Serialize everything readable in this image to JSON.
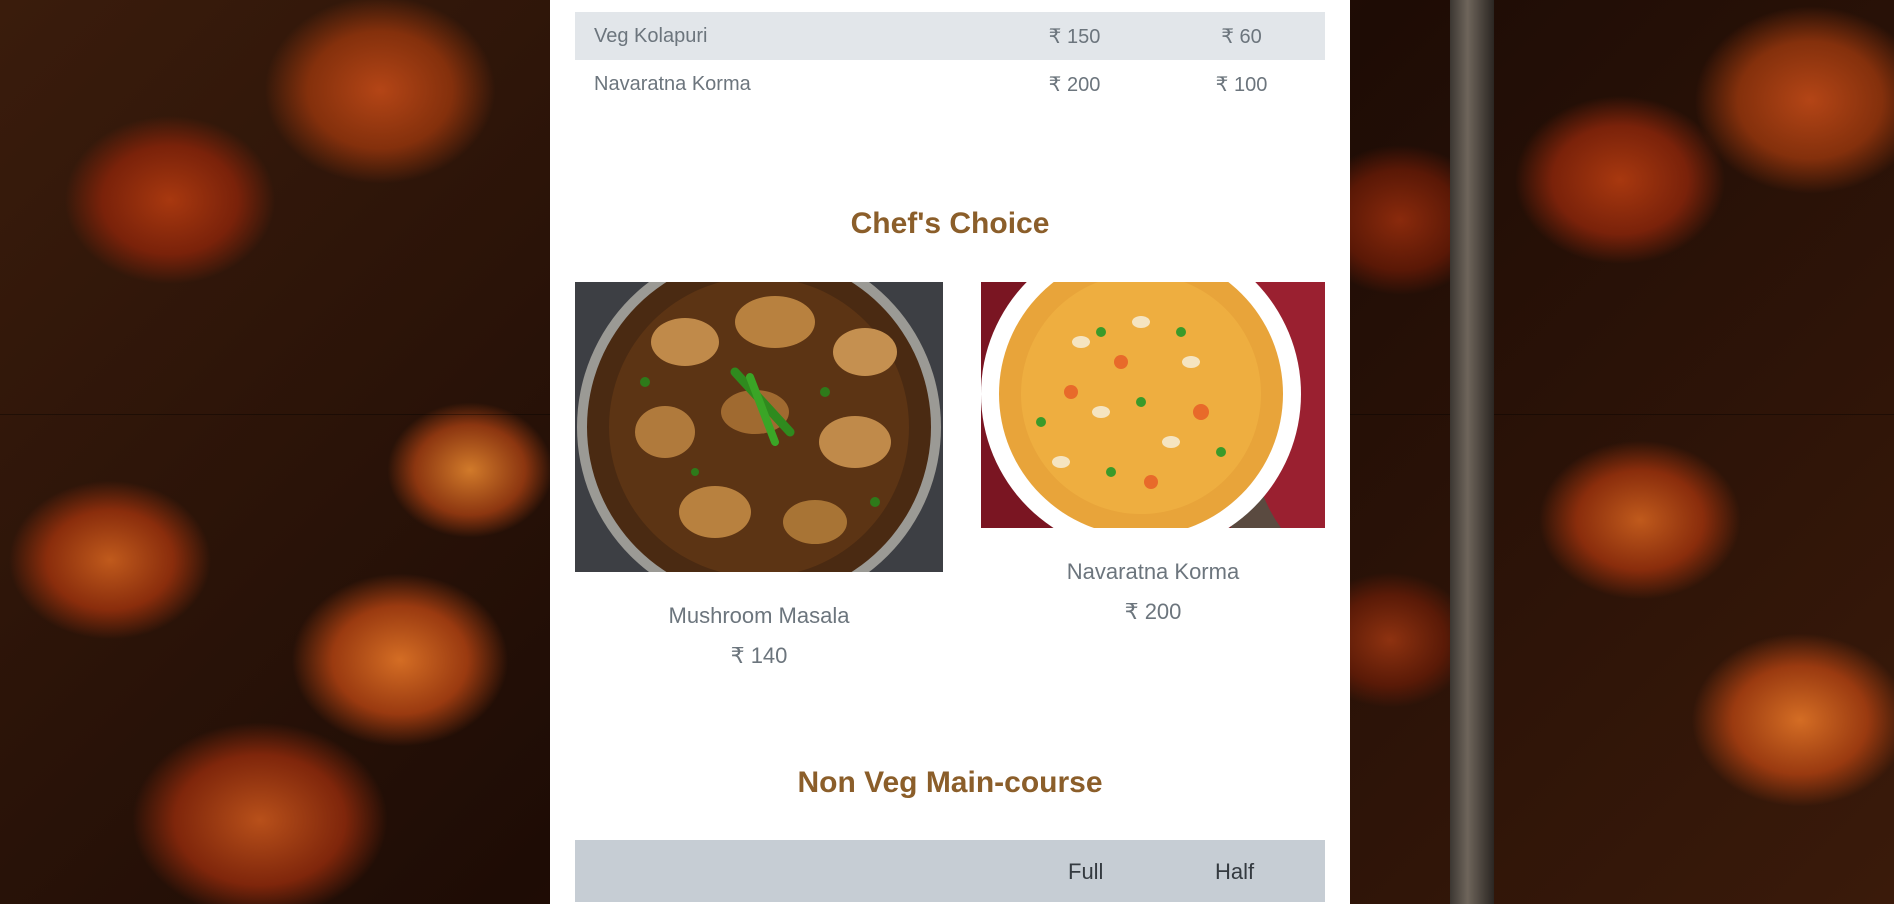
{
  "veg_table": {
    "rows": [
      {
        "name": "Veg Kolapuri",
        "full": "₹ 150",
        "half": "₹ 60"
      },
      {
        "name": "Navaratna Korma",
        "full": "₹ 200",
        "half": "₹ 100"
      }
    ]
  },
  "chefs_choice": {
    "title": "Chef's Choice",
    "items": [
      {
        "name": "Mushroom Masala",
        "price": "₹ 140"
      },
      {
        "name": "Navaratna Korma",
        "price": "₹ 200"
      }
    ]
  },
  "non_veg": {
    "title": "Non Veg Main-course",
    "header": {
      "full": "Full",
      "half": "Half"
    }
  },
  "colors": {
    "section_title": "#8b5e2a",
    "stripe_row": "#e2e6ea",
    "table_header": "#c6cdd4",
    "muted_text": "#6c757d"
  },
  "icons": {
    "background": "chicken-wings-photo",
    "dish_1": "mushroom-masala-photo",
    "dish_2": "navaratna-korma-photo"
  }
}
